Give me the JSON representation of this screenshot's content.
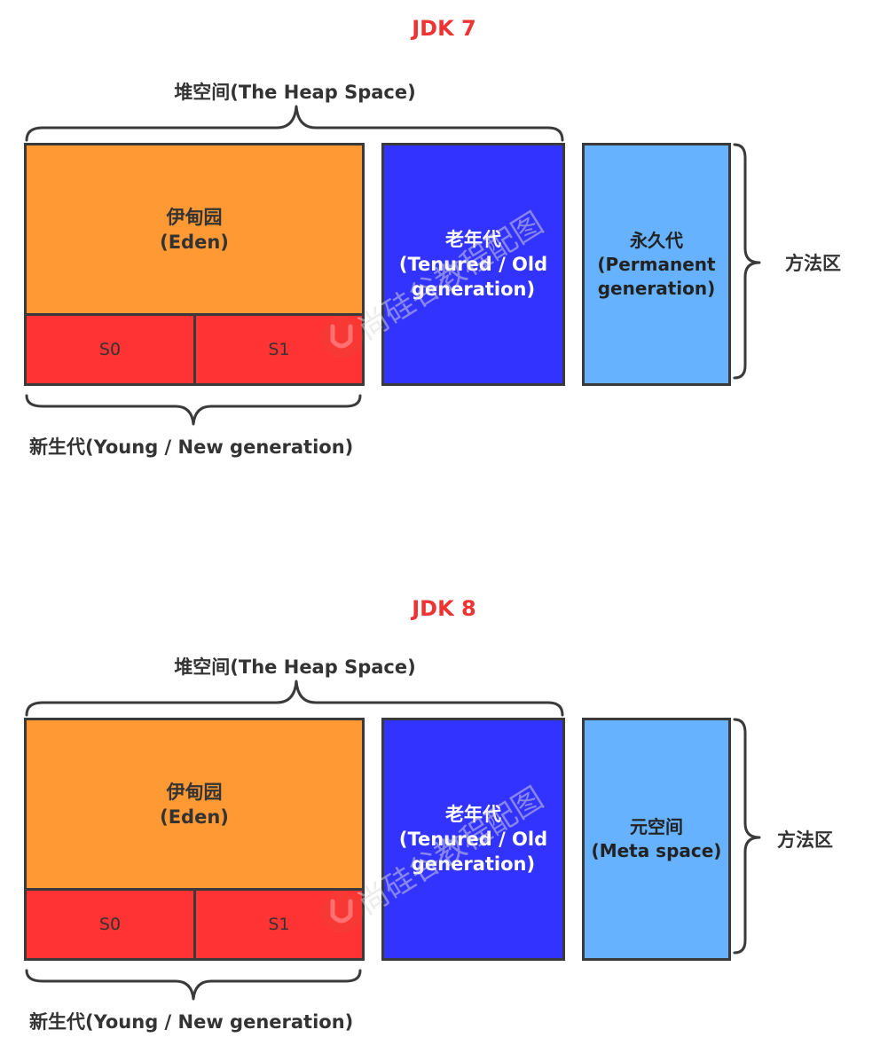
{
  "colors": {
    "title": "#ee3333",
    "eden": "#ff9933",
    "survivor": "#ff3333",
    "tenured": "#3333ff",
    "permanent": "#66b2ff",
    "stroke": "#3a3a3a",
    "watermark": "#e8443a"
  },
  "watermark": {
    "text": "尚硅谷教程配图",
    "icon": "atguigu-logo-icon"
  },
  "jdk7": {
    "title": "JDK 7",
    "heap_label": "堆空间(The Heap Space)",
    "eden": {
      "line1": "伊甸园",
      "line2": "(Eden)"
    },
    "s0": "S0",
    "s1": "S1",
    "tenured": {
      "line1": "老年代",
      "line2": "(Tenured / Old",
      "line3": "generation)"
    },
    "perm": {
      "line1": "永久代",
      "line2": "(Permanent",
      "line3": "generation)"
    },
    "method_area": "方法区",
    "young_label": "新生代(Young / New generation)"
  },
  "jdk8": {
    "title": "JDK 8",
    "heap_label": "堆空间(The Heap Space)",
    "eden": {
      "line1": "伊甸园",
      "line2": "(Eden)"
    },
    "s0": "S0",
    "s1": "S1",
    "tenured": {
      "line1": "老年代",
      "line2": "(Tenured / Old",
      "line3": "generation)"
    },
    "meta": {
      "line1": "元空间",
      "line2": "(Meta space)"
    },
    "method_area": "方法区",
    "young_label": "新生代(Young / New generation)"
  }
}
